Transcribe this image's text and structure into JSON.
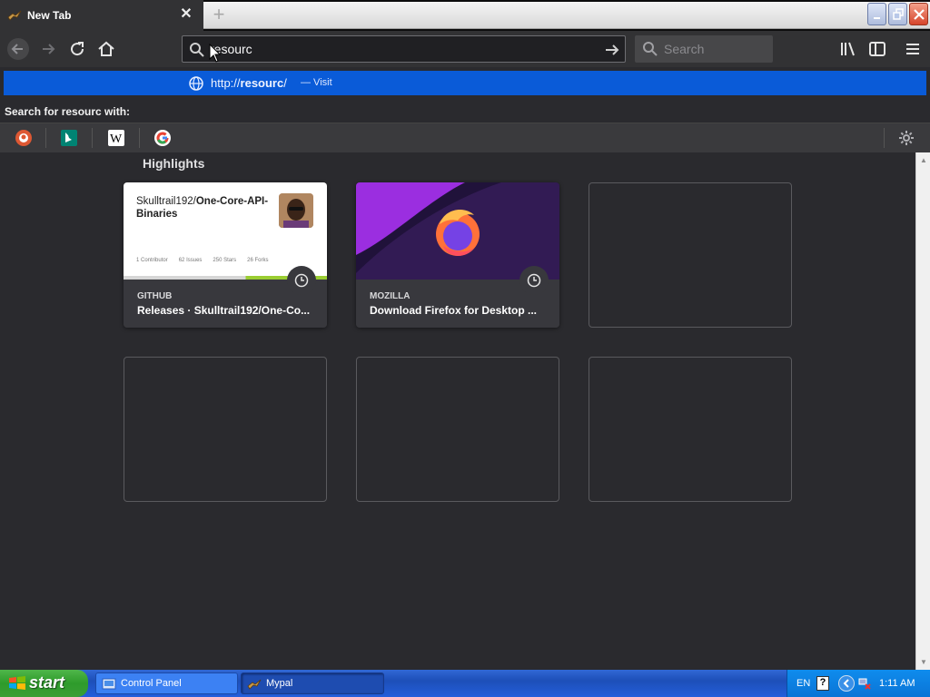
{
  "browser": {
    "tab": {
      "title": "New Tab",
      "close": "✕"
    },
    "new_tab": "+",
    "window_controls": [
      "minimize",
      "maximize",
      "close"
    ],
    "toolbar": {
      "back": "back-icon",
      "forward": "forward-icon",
      "reload": "reload-icon",
      "home": "home-icon",
      "url_value": "resourc",
      "search_placeholder": "Search",
      "library": "library-icon",
      "sidebar": "sidebar-icon",
      "menu": "menu-icon"
    },
    "dropdown": {
      "suggestion_prefix": "http://",
      "suggestion_bold": "resourc",
      "suggestion_suffix": "/",
      "suggestion_action": "— Visit",
      "search_with": "Search for resourc with:",
      "engines": [
        "duckduckgo",
        "bing",
        "wikipedia",
        "google"
      ]
    }
  },
  "newtab": {
    "section_title": "Highlights",
    "cards": [
      {
        "source": "GITHUB",
        "title": "Releases · Skulltrail192/One-Co...",
        "thumb_title_plain": "Skulltrail192/",
        "thumb_title_bold": "One-Core-API-Binaries",
        "stats": [
          {
            "value": "1",
            "label": "Contributor"
          },
          {
            "value": "62",
            "label": "Issues"
          },
          {
            "value": "250",
            "label": "Stars"
          },
          {
            "value": "26",
            "label": "Forks"
          }
        ]
      },
      {
        "source": "MOZILLA",
        "title": "Download Firefox for Desktop ..."
      }
    ]
  },
  "taskbar": {
    "start": "start",
    "tasks": [
      "Control Panel",
      "Mypal"
    ],
    "lang": "EN",
    "help": "?",
    "time": "1:11 AM"
  }
}
